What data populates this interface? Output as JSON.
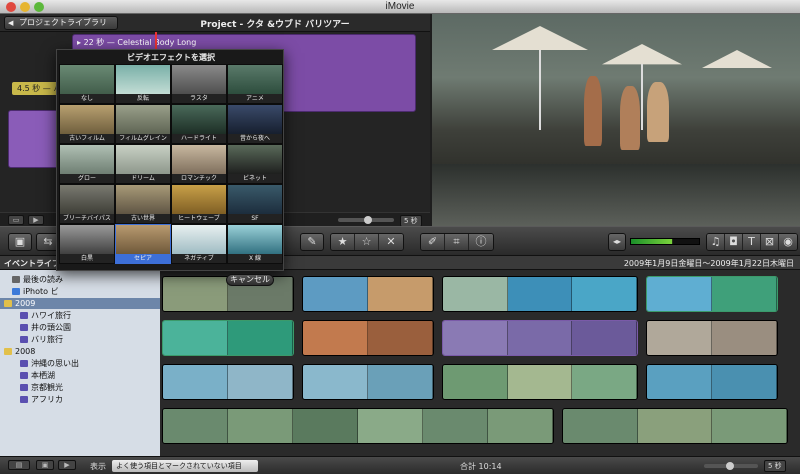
{
  "window": {
    "title": "iMovie"
  },
  "project_bar": {
    "library_button": "プロジェクトライブラリ",
    "title": "Project - クタ &ウブド バリツアー"
  },
  "project": {
    "clip_label": "22 秒 — Celestial Body Long",
    "duration_badge": "4.5 秒 — ハ"
  },
  "project_controls": {
    "zoom_value": "5 秒"
  },
  "effects": {
    "title": "ビデオエフェクトを選択",
    "items": [
      {
        "label": "なし"
      },
      {
        "label": "反転"
      },
      {
        "label": "ラスタ"
      },
      {
        "label": "アニメ"
      },
      {
        "label": "古いフィルム"
      },
      {
        "label": "フィルムグレイン"
      },
      {
        "label": "ハードライト"
      },
      {
        "label": "昔から夜へ"
      },
      {
        "label": "グロー"
      },
      {
        "label": "ドリーム"
      },
      {
        "label": "ロマンチック"
      },
      {
        "label": "ビネット"
      },
      {
        "label": "ブリーチバイパス"
      },
      {
        "label": "古い世界"
      },
      {
        "label": "ヒートウェーブ"
      },
      {
        "label": "SF"
      },
      {
        "label": "白黒"
      },
      {
        "label": "セピア"
      },
      {
        "label": "ネガティブ"
      },
      {
        "label": "X 線"
      }
    ],
    "selected": "セピア",
    "cancel_label": "キャンセル"
  },
  "events": {
    "header": "イベントライブラ",
    "items": [
      {
        "label": "最後の読み",
        "type": "cam"
      },
      {
        "label": "iPhoto ビ",
        "type": "iph"
      },
      {
        "label": "2009",
        "type": "folder"
      },
      {
        "label": "ハワイ旅行",
        "type": "star"
      },
      {
        "label": "井の頭公園",
        "type": "star"
      },
      {
        "label": "バリ旅行",
        "type": "star"
      },
      {
        "label": "2008",
        "type": "folder"
      },
      {
        "label": "沖縄の思い出",
        "type": "star"
      },
      {
        "label": "本栖湖",
        "type": "star"
      },
      {
        "label": "京都観光",
        "type": "star"
      },
      {
        "label": "アフリカ",
        "type": "star"
      }
    ],
    "selected": "2009"
  },
  "browser": {
    "date_range": "2009年1月9日金曜日〜2009年1月22日木曜日"
  },
  "bottom_bar": {
    "show_label": "表示",
    "show_value": "よく使う項目とマークされていない項目",
    "total": "合計 10:14",
    "zoom_value": "5 秒"
  },
  "colors": {
    "accent": "#3d6fd8",
    "clip_purple": "#7c4ca6",
    "selected_event": "#6d86a9"
  }
}
